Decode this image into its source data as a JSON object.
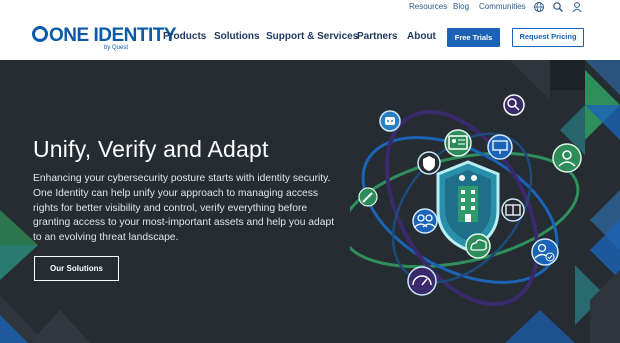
{
  "utility": {
    "links": [
      "Resources",
      "Blog",
      "Communities"
    ],
    "icons": [
      "globe-icon",
      "search-icon",
      "user-icon"
    ]
  },
  "brand": {
    "name": "ONE IDENTITY",
    "byline": "by Quest"
  },
  "nav": {
    "items": [
      "Products",
      "Solutions",
      "Support & Services",
      "Partners",
      "About"
    ],
    "primary_button": "Free Trials",
    "secondary_button": "Request Pricing"
  },
  "hero": {
    "title": "Unify, Verify and Adapt",
    "description": "Enhancing your cybersecurity posture starts with identity security. One Identity can help unify your approach to managing access rights for better visibility and control, verify everything before granting access to your most-important assets and help you adapt to an evolving threat landscape.",
    "cta": "Our Solutions",
    "illustration_icons": [
      "robot-icon",
      "search-user-icon",
      "id-card-icon",
      "monitor-icon",
      "shield-icon",
      "key-icon",
      "users-icon",
      "cloud-icon",
      "window-icon",
      "admin-user-icon",
      "user-check-icon",
      "gauge-icon",
      "building-shield-icon"
    ]
  },
  "colors": {
    "brand_blue": "#0b5aa8",
    "button_blue": "#1b63b6",
    "hero_bg": "#252c32",
    "accent_green": "#2f8f5a",
    "accent_teal": "#2a7f86"
  }
}
